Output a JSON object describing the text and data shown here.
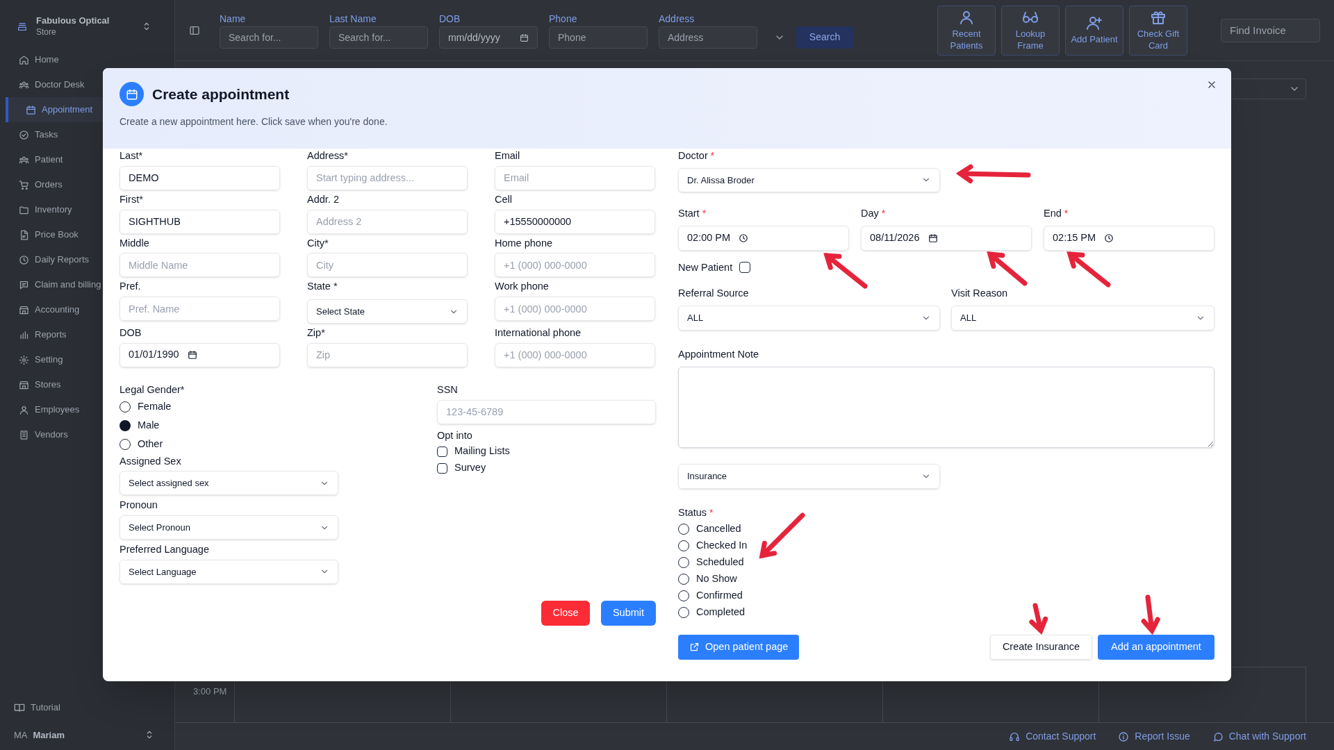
{
  "sidebar": {
    "store_name": "Fabulous Optical",
    "store_type": "Store",
    "items": [
      {
        "label": "Home",
        "selected": false
      },
      {
        "label": "Doctor Desk",
        "selected": false
      },
      {
        "label": "Appointment",
        "selected": true
      },
      {
        "label": "Tasks",
        "selected": false
      },
      {
        "label": "Patient",
        "selected": false
      },
      {
        "label": "Orders",
        "selected": false
      },
      {
        "label": "Inventory",
        "selected": false
      },
      {
        "label": "Price Book",
        "selected": false
      },
      {
        "label": "Daily Reports",
        "selected": false
      },
      {
        "label": "Claim and billing",
        "selected": false
      },
      {
        "label": "Accounting",
        "selected": false
      },
      {
        "label": "Reports",
        "selected": false
      },
      {
        "label": "Setting",
        "selected": false
      },
      {
        "label": "Stores",
        "selected": false
      },
      {
        "label": "Employees",
        "selected": false
      },
      {
        "label": "Vendors",
        "selected": false
      }
    ],
    "tutorial": "Tutorial",
    "user": {
      "initials": "MA",
      "name": "Mariam"
    }
  },
  "search_bar": {
    "fields": [
      {
        "label": "Name",
        "placeholder": "Search for...",
        "kind": "text"
      },
      {
        "label": "Last Name",
        "placeholder": "Search for...",
        "kind": "text"
      },
      {
        "label": "DOB",
        "placeholder": "mm/dd/yyyy",
        "kind": "date"
      },
      {
        "label": "Phone",
        "placeholder": "Phone",
        "kind": "text"
      },
      {
        "label": "Address",
        "placeholder": "Address",
        "kind": "text"
      }
    ],
    "search_button": "Search"
  },
  "actions": [
    "Recent Patients",
    "Lookup Frame",
    "Add Patient",
    "Check Gift Card"
  ],
  "find_invoice": {
    "placeholder": "Find Invoice"
  },
  "calendar": {
    "time_label": "3:00 PM"
  },
  "footer_links": [
    "Contact Support",
    "Report Issue",
    "Chat with Support"
  ],
  "dialog": {
    "title": "Create appointment",
    "description": "Create a new appointment here. Click save when you're done.",
    "patient_fields": [
      [
        {
          "label": "Last*",
          "kind": "text",
          "value": "DEMO"
        },
        {
          "label": "First*",
          "kind": "text",
          "value": "SIGHTHUB"
        },
        {
          "label": "Middle",
          "kind": "text",
          "placeholder": "Middle Name"
        },
        {
          "label": "Pref.",
          "kind": "text",
          "placeholder": "Pref. Name"
        },
        {
          "label": "DOB",
          "kind": "date",
          "value": "01/01/1990"
        }
      ],
      [
        {
          "label": "Address*",
          "kind": "text",
          "placeholder": "Start typing address..."
        },
        {
          "label": "Addr. 2",
          "kind": "text",
          "placeholder": "Address 2"
        },
        {
          "label": "City*",
          "kind": "text",
          "placeholder": "City"
        },
        {
          "label": "State *",
          "kind": "select",
          "value": "Select State"
        },
        {
          "label": "Zip*",
          "kind": "text",
          "placeholder": "Zip"
        }
      ],
      [
        {
          "label": "Email",
          "kind": "text",
          "placeholder": "Email"
        },
        {
          "label": "Cell",
          "kind": "text",
          "value": "+15550000000"
        },
        {
          "label": "Home phone",
          "kind": "text",
          "placeholder": "+1 (000) 000-0000"
        },
        {
          "label": "Work phone",
          "kind": "text",
          "placeholder": "+1 (000) 000-0000"
        },
        {
          "label": "International phone",
          "kind": "text",
          "placeholder": "+1 (000) 000-0000"
        }
      ]
    ],
    "legal_gender": {
      "label": "Legal Gender*",
      "options": [
        {
          "label": "Female",
          "selected": false
        },
        {
          "label": "Male",
          "selected": true
        },
        {
          "label": "Other",
          "selected": false
        }
      ]
    },
    "selects": [
      {
        "label": "Assigned Sex",
        "value": "Select assigned sex"
      },
      {
        "label": "Pronoun",
        "value": "Select Pronoun"
      },
      {
        "label": "Preferred Language",
        "value": "Select Language"
      }
    ],
    "ssn": {
      "label": "SSN",
      "placeholder": "123-45-6789"
    },
    "opt_into": {
      "label": "Opt into",
      "options": [
        {
          "label": "Mailing Lists",
          "checked": false
        },
        {
          "label": "Survey",
          "checked": false
        }
      ]
    },
    "close_button": "Close",
    "submit_button": "Submit",
    "doctor": {
      "label": "Doctor",
      "required_mark": "*",
      "value": "Dr. Alissa Broder"
    },
    "times": [
      {
        "label": "Start",
        "required_mark": "*",
        "value": "02:00 PM",
        "kind": "time"
      },
      {
        "label": "Day",
        "required_mark": "*",
        "value": "08/11/2026",
        "kind": "date"
      },
      {
        "label": "End",
        "required_mark": "*",
        "value": "02:15 PM",
        "kind": "time"
      }
    ],
    "new_patient": {
      "label": "New Patient",
      "checked": false
    },
    "referral_source": {
      "label": "Referral Source",
      "value": "ALL"
    },
    "visit_reason": {
      "label": "Visit Reason",
      "value": "ALL"
    },
    "appointment_note": {
      "label": "Appointment Note"
    },
    "insurance": {
      "value": "Insurance"
    },
    "status": {
      "label": "Status",
      "required_mark": "*",
      "options": [
        {
          "label": "Cancelled",
          "selected": false
        },
        {
          "label": "Checked In",
          "selected": false
        },
        {
          "label": "Scheduled",
          "selected": false
        },
        {
          "label": "No Show",
          "selected": false
        },
        {
          "label": "Confirmed",
          "selected": false
        },
        {
          "label": "Completed",
          "selected": false
        }
      ]
    },
    "open_patient_button": "Open patient page",
    "create_insurance_button": "Create Insurance",
    "add_appointment_button": "Add an appointment"
  }
}
